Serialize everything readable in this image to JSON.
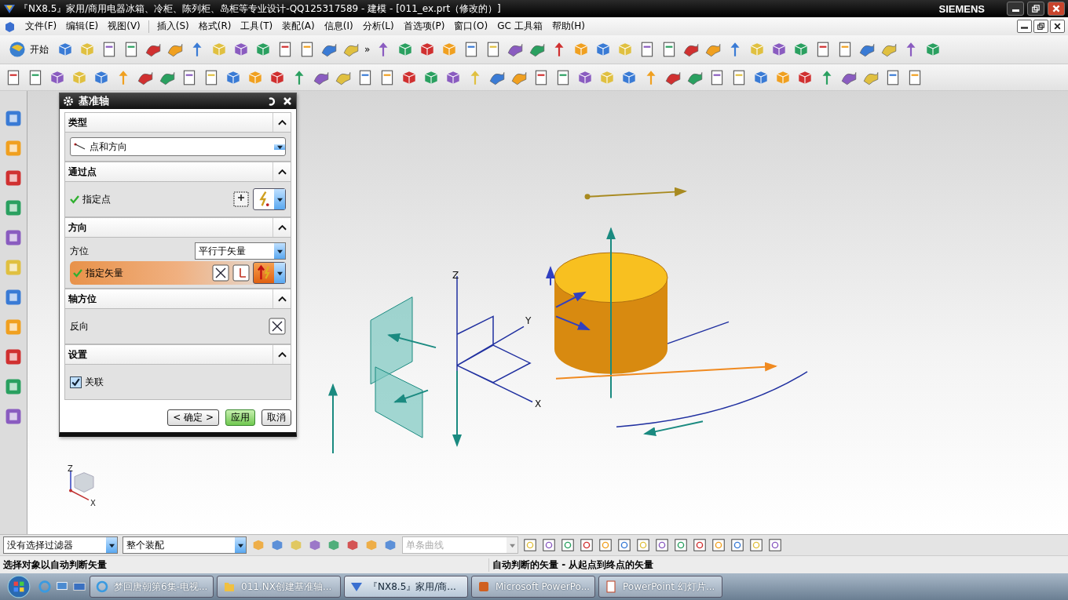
{
  "window": {
    "title": "『NX8.5』家用/商用电器冰箱、冷柜、陈列柜、岛柜等专业设计-QQ125317589 - 建模 - [011_ex.prt（修改的）]",
    "brand": "SIEMENS"
  },
  "menu": [
    "文件(F)",
    "编辑(E)",
    "视图(V)",
    "插入(S)",
    "格式(R)",
    "工具(T)",
    "装配(A)",
    "信息(I)",
    "分析(L)",
    "首选项(P)",
    "窗口(O)",
    "GC 工具箱",
    "帮助(H)"
  ],
  "toolbar": {
    "start": "开始",
    "overflow": "»"
  },
  "dialog": {
    "title": "基准轴",
    "sections": [
      {
        "kind": "type",
        "title": "类型",
        "expanded": true,
        "value": "点和方向"
      },
      {
        "kind": "point",
        "title": "通过点",
        "expanded": true,
        "label": "指定点",
        "done": true
      },
      {
        "kind": "direction",
        "title": "方向",
        "expanded": true,
        "orient_label": "方位",
        "orient_value": "平行于矢量",
        "label": "指定矢量",
        "done": true
      },
      {
        "kind": "reverse",
        "title": "轴方位",
        "expanded": true,
        "label": "反向"
      },
      {
        "kind": "settings",
        "title": "设置",
        "expanded": true,
        "label": "关联",
        "checked": true
      }
    ],
    "buttons": [
      {
        "label": "< 确定 >",
        "default": false
      },
      {
        "label": "应用",
        "default": true
      },
      {
        "label": "取消",
        "default": false
      }
    ]
  },
  "viewport": {
    "axis_z": "Z",
    "axis_y": "Y",
    "axis_x": "X",
    "triad_z": "Z",
    "triad_x": "X"
  },
  "selection_bar": {
    "filter": "没有选择过滤器",
    "scope": "整个装配",
    "curve_rule": "单条曲线",
    "curve_rule_disabled": true
  },
  "status": {
    "left": "选择对象以自动判断矢量",
    "right": "自动判断的矢量 - 从起点到终点的矢量"
  },
  "taskbar": [
    {
      "label": "梦回唐朝第6集-电视...",
      "kind": "browser",
      "selected": false
    },
    {
      "label": "011.NX创建基准轴...",
      "kind": "folder",
      "selected": false
    },
    {
      "label": "『NX8.5』家用/商...",
      "kind": "nx",
      "selected": true
    },
    {
      "label": "Microsoft PowerPo...",
      "kind": "ppt",
      "selected": false
    },
    {
      "label": "PowerPoint 幻灯片...",
      "kind": "doc",
      "selected": false
    }
  ]
}
